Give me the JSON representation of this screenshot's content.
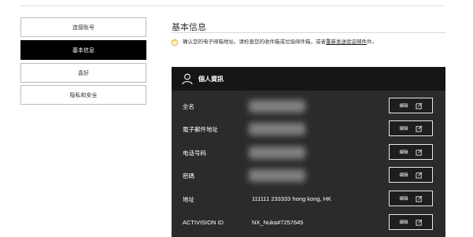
{
  "sidebar": {
    "items": [
      {
        "label": "连接账号",
        "active": false
      },
      {
        "label": "基本信息",
        "active": true
      },
      {
        "label": "喜好",
        "active": false
      },
      {
        "label": "隐私和安全",
        "active": false
      }
    ]
  },
  "main": {
    "title": "基本信息",
    "notice": {
      "text": "确认您的电子邮箱地址。请检查您的收件箱或垃圾邮件箱，或者",
      "link": "重新发送验证邮件",
      "suffix": "件。"
    },
    "card": {
      "title": "個人資訊",
      "edit_label": "编辑",
      "rows": [
        {
          "label": "全名",
          "value": null
        },
        {
          "label": "電子郵件地址",
          "value": null
        },
        {
          "label": "电话号码",
          "value": null
        },
        {
          "label": "密碼",
          "value": null
        },
        {
          "label": "地址",
          "value": "111111 233333 hong kong, HK"
        },
        {
          "label": "ACTIVISION ID",
          "value": "NX_Nuka#7257645"
        }
      ]
    }
  },
  "colors": {
    "card_bg": "#2b2b2b",
    "card_header_bg": "#151515",
    "active_nav_bg": "#000000",
    "notice_icon": "#e0a800"
  }
}
